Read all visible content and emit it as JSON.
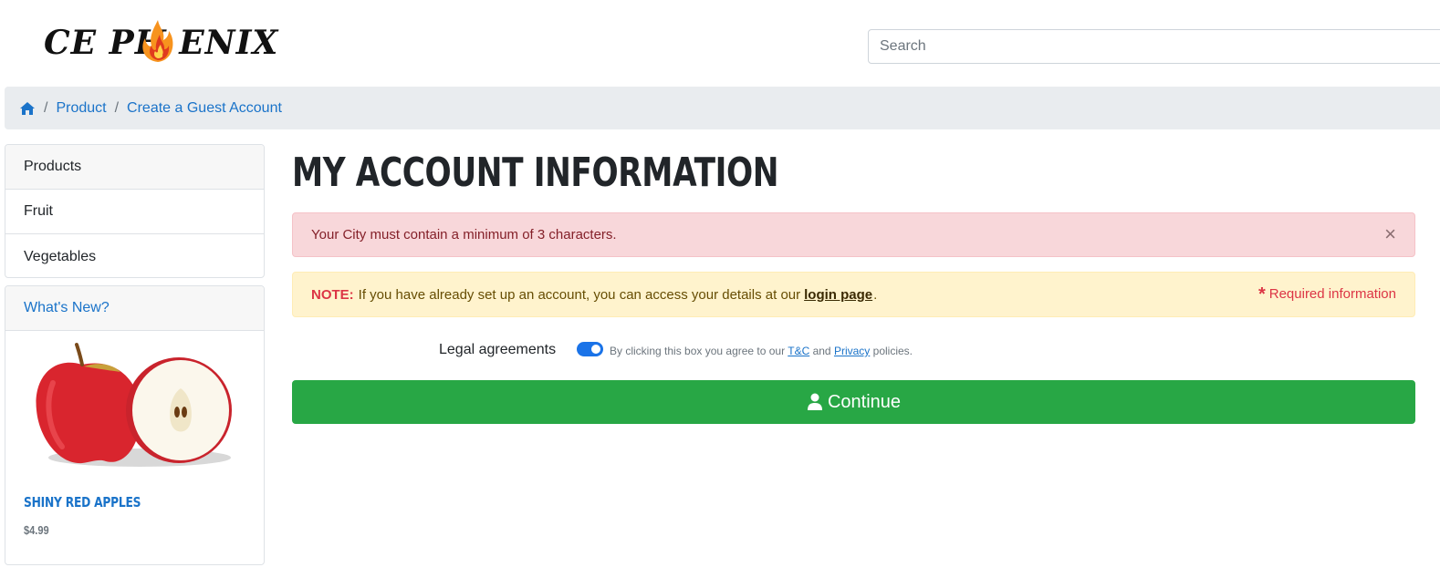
{
  "header": {
    "logo_text": "CE PH   ENIX",
    "search_placeholder": "Search"
  },
  "breadcrumb": {
    "home_icon": "home-icon",
    "items": [
      "Product",
      "Create a Guest Account"
    ]
  },
  "sidebar": {
    "categories": {
      "heading": "Products",
      "items": [
        "Fruit",
        "Vegetables"
      ]
    },
    "whats_new": {
      "heading": "What's New?",
      "product_name": "Shiny Red Apples",
      "price": "$4.99"
    }
  },
  "main": {
    "title": "My Account Information",
    "error_alert": "Your City must contain a minimum of 3 characters.",
    "close_symbol": "×",
    "note": {
      "label": "NOTE:",
      "text": "If you have already set up an account, you can access your details at our",
      "link": "login page",
      "end": ".",
      "required_symbol": "*",
      "required_text": "Required information"
    },
    "legal": {
      "label": "Legal agreements",
      "text_before": "By clicking this box you agree to our",
      "tc_link": "T&C",
      "and": "and",
      "privacy_link": "Privacy",
      "text_after": "policies."
    },
    "continue_label": "Continue"
  },
  "colors": {
    "primary_link": "#1a73c9",
    "success": "#28a745",
    "danger_bg": "#f8d7da",
    "warning_bg": "#fff3cd"
  }
}
